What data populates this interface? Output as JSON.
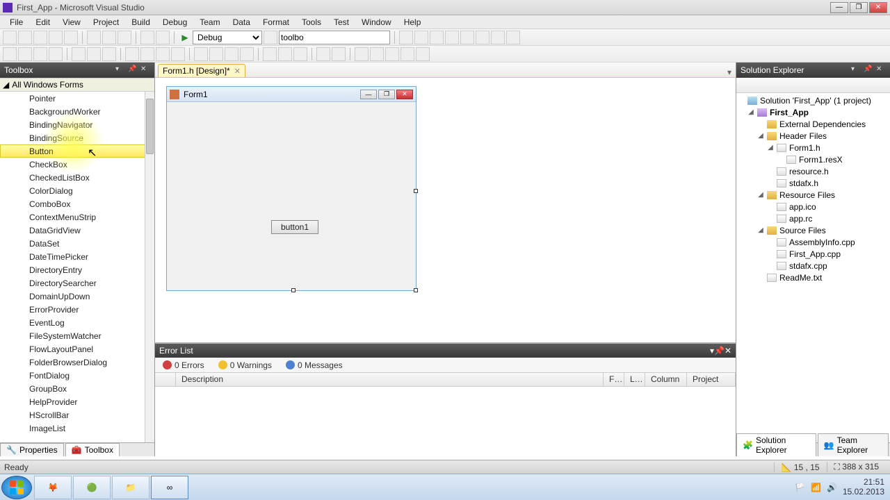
{
  "window": {
    "title": "First_App - Microsoft Visual Studio"
  },
  "menu": [
    "File",
    "Edit",
    "View",
    "Project",
    "Build",
    "Debug",
    "Team",
    "Data",
    "Format",
    "Tools",
    "Test",
    "Window",
    "Help"
  ],
  "toolbar1": {
    "config_select": "Debug",
    "search_value": "toolbo"
  },
  "toolbox": {
    "title": "Toolbox",
    "group": "All Windows Forms",
    "items": [
      "Pointer",
      "BackgroundWorker",
      "BindingNavigator",
      "BindingSource",
      "Button",
      "CheckBox",
      "CheckedListBox",
      "ColorDialog",
      "ComboBox",
      "ContextMenuStrip",
      "DataGridView",
      "DataSet",
      "DateTimePicker",
      "DirectoryEntry",
      "DirectorySearcher",
      "DomainUpDown",
      "ErrorProvider",
      "EventLog",
      "FileSystemWatcher",
      "FlowLayoutPanel",
      "FolderBrowserDialog",
      "FontDialog",
      "GroupBox",
      "HelpProvider",
      "HScrollBar",
      "ImageList"
    ],
    "selected": "Button",
    "bottom_tabs": {
      "properties": "Properties",
      "toolbox": "Toolbox"
    }
  },
  "document": {
    "tab": "Form1.h [Design]*",
    "form_title": "Form1",
    "button_text": "button1"
  },
  "errorlist": {
    "title": "Error List",
    "errors": "0 Errors",
    "warnings": "0 Warnings",
    "messages": "0 Messages",
    "cols": {
      "desc": "Description",
      "file": "F…",
      "line": "L…",
      "col": "Column",
      "project": "Project"
    }
  },
  "solution": {
    "title": "Solution Explorer",
    "root": "Solution 'First_App' (1 project)",
    "project": "First_App",
    "nodes": {
      "ext_deps": "External Dependencies",
      "header_files": "Header Files",
      "form_h": "Form1.h",
      "form_resx": "Form1.resX",
      "resource_h": "resource.h",
      "stdafx_h": "stdafx.h",
      "resource_files": "Resource Files",
      "app_ico": "app.ico",
      "app_rc": "app.rc",
      "source_files": "Source Files",
      "asm_info": "AssemblyInfo.cpp",
      "first_app_cpp": "First_App.cpp",
      "stdafx_cpp": "stdafx.cpp",
      "readme": "ReadMe.txt"
    },
    "bottom_tabs": {
      "sol": "Solution Explorer",
      "team": "Team Explorer"
    }
  },
  "status": {
    "ready": "Ready",
    "coords": "15 , 15",
    "size": "388 x 315"
  },
  "taskbar": {
    "time": "21:51",
    "date": "15.02.2013"
  }
}
